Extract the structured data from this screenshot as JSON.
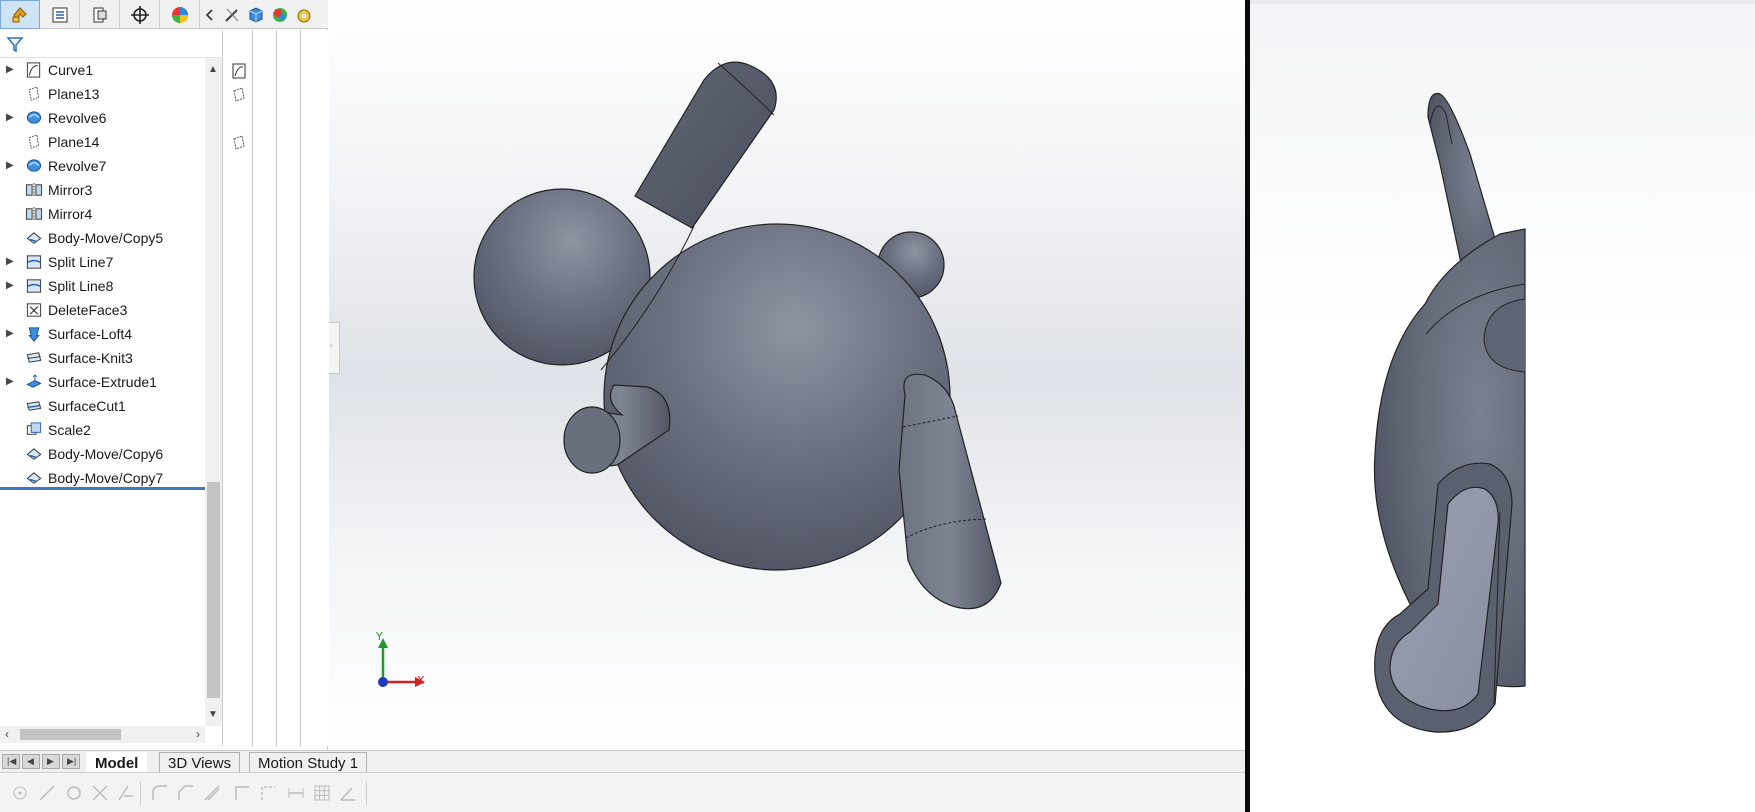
{
  "panel_tabs": [
    {
      "name": "featuremanager-tab",
      "icon": "featuremanager-icon",
      "active": true
    },
    {
      "name": "propertymanager-tab",
      "icon": "propertymanager-icon",
      "active": false
    },
    {
      "name": "configurationmanager-tab",
      "icon": "configurationmanager-icon",
      "active": false
    },
    {
      "name": "dimxpert-tab",
      "icon": "dimxpert-icon",
      "active": false
    },
    {
      "name": "displaymanager-tab",
      "icon": "displaymanager-icon",
      "active": false
    }
  ],
  "tree": {
    "items": [
      {
        "label": "Curve1",
        "icon": "curve-icon",
        "expandable": true
      },
      {
        "label": "Plane13",
        "icon": "plane-icon",
        "expandable": false
      },
      {
        "label": "Revolve6",
        "icon": "revolve-icon",
        "expandable": true
      },
      {
        "label": "Plane14",
        "icon": "plane-icon",
        "expandable": false
      },
      {
        "label": "Revolve7",
        "icon": "revolve-icon",
        "expandable": true
      },
      {
        "label": "Mirror3",
        "icon": "mirror-icon",
        "expandable": false
      },
      {
        "label": "Mirror4",
        "icon": "mirror-icon",
        "expandable": false
      },
      {
        "label": "Body-Move/Copy5",
        "icon": "move-copy-icon",
        "expandable": false
      },
      {
        "label": "Split Line7",
        "icon": "split-line-icon",
        "expandable": true
      },
      {
        "label": "Split Line8",
        "icon": "split-line-icon",
        "expandable": true
      },
      {
        "label": "DeleteFace3",
        "icon": "delete-face-icon",
        "expandable": false
      },
      {
        "label": "Surface-Loft4",
        "icon": "surface-loft-icon",
        "expandable": true
      },
      {
        "label": "Surface-Knit3",
        "icon": "surface-knit-icon",
        "expandable": false
      },
      {
        "label": "Surface-Extrude1",
        "icon": "surface-extrude-icon",
        "expandable": true
      },
      {
        "label": "SurfaceCut1",
        "icon": "surface-cut-icon",
        "expandable": false
      },
      {
        "label": "Scale2",
        "icon": "scale-icon",
        "expandable": false
      },
      {
        "label": "Body-Move/Copy6",
        "icon": "move-copy-icon",
        "expandable": false
      },
      {
        "label": "Body-Move/Copy7",
        "icon": "move-copy-icon",
        "expandable": false,
        "selected": true
      }
    ]
  },
  "triad": {
    "y": "Y",
    "x": "X"
  },
  "bottom_tabs": [
    "Model",
    "3D Views",
    "Motion Study 1"
  ],
  "colors": {
    "accent": "#3f79c4",
    "model_gray": "#6b7080",
    "triad_x": "#d42020",
    "triad_y": "#1f9a2c",
    "triad_origin": "#1c3bb8"
  }
}
